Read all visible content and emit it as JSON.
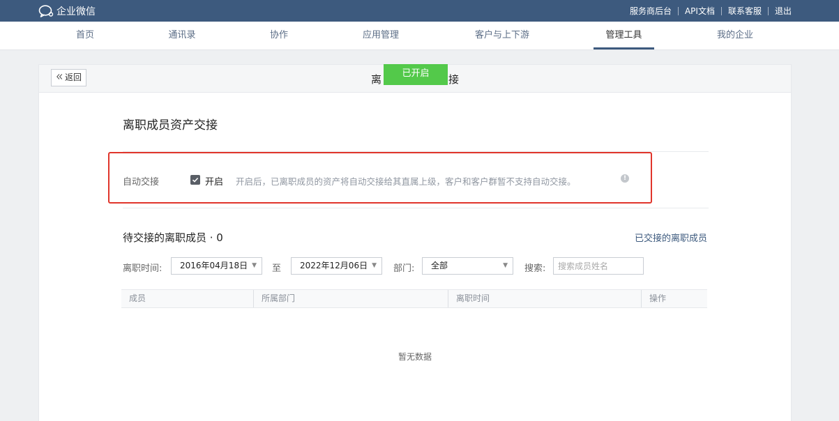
{
  "app": {
    "name": "企业微信",
    "logo_icon": "chat-bubble-icon"
  },
  "top_links": [
    "服务商后台",
    "API文档",
    "联系客服",
    "退出"
  ],
  "nav": {
    "items": [
      "首页",
      "通讯录",
      "协作",
      "应用管理",
      "客户与上下游",
      "管理工具",
      "我的企业"
    ],
    "active": "管理工具"
  },
  "page": {
    "back_label": "返回",
    "title_left": "离",
    "title_right": "接",
    "toast": "已开启",
    "section_title": "离职成员资产交接",
    "auto_label": "自动交接",
    "auto_checked": true,
    "auto_check_label": "开启",
    "auto_desc": "开启后，已离职成员的资产将自动交接给其直属上级，客户和客户群暂不支持自动交接。",
    "pending_title": "待交接的离职成员 · 0",
    "handed_link": "已交接的离职成员",
    "filters": {
      "date_label": "离职时间:",
      "date_start": "2016年04月18日",
      "to_label": "至",
      "date_end": "2022年12月06日",
      "dept_label": "部门:",
      "dept_value": "全部",
      "search_label": "搜索:",
      "search_placeholder": "搜索成员姓名",
      "search_value": ""
    },
    "table": {
      "columns": [
        "成员",
        "所属部门",
        "离职时间",
        "操作"
      ],
      "rows": [],
      "empty_text": "暂无数据"
    }
  },
  "colors": {
    "topbar": "#3d5a7e",
    "toast": "#53c94a",
    "highlight": "#e0352b"
  }
}
